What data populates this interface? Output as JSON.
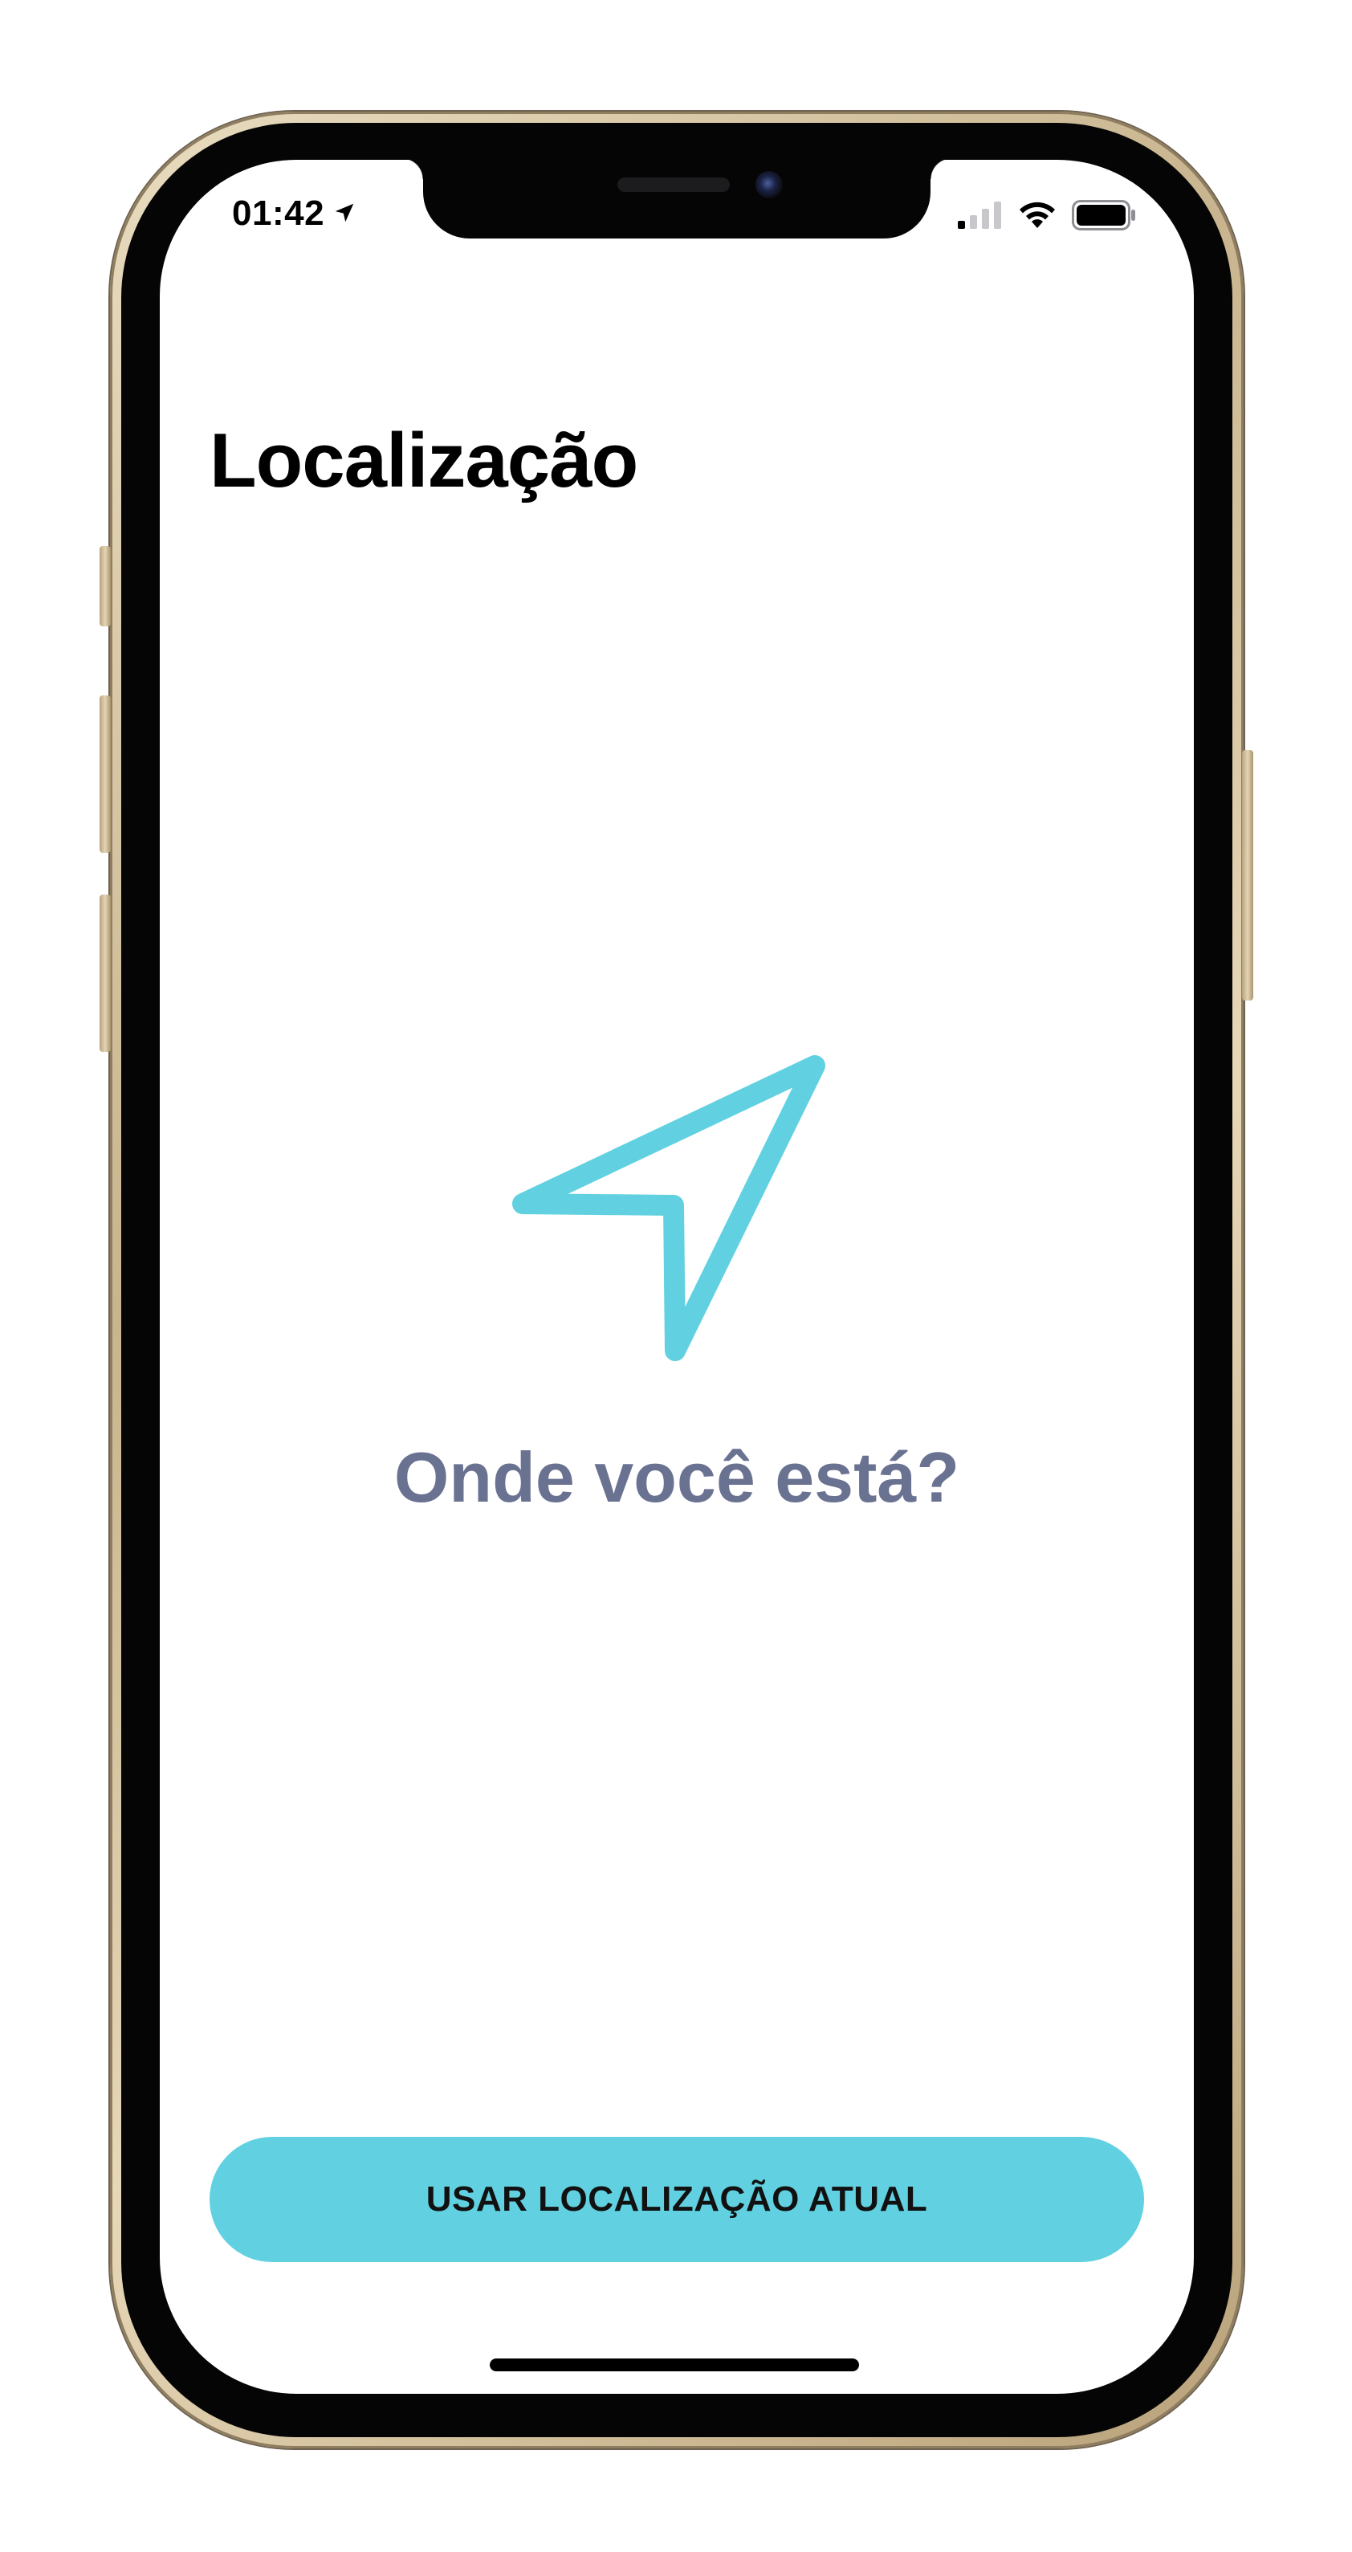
{
  "status_bar": {
    "time": "01:42",
    "location_icon": "location-arrow-icon",
    "signal_icon": "cellular-signal-icon",
    "wifi_icon": "wifi-icon",
    "battery_icon": "battery-icon"
  },
  "header": {
    "title": "Localização"
  },
  "main": {
    "icon": "navigation-arrow-icon",
    "prompt": "Onde você está?"
  },
  "footer": {
    "button_label": "USAR LOCALIZAÇÃO ATUAL"
  },
  "colors": {
    "accent": "#61d1e1",
    "prompt_text": "#6a7291",
    "title_text": "#000000"
  }
}
